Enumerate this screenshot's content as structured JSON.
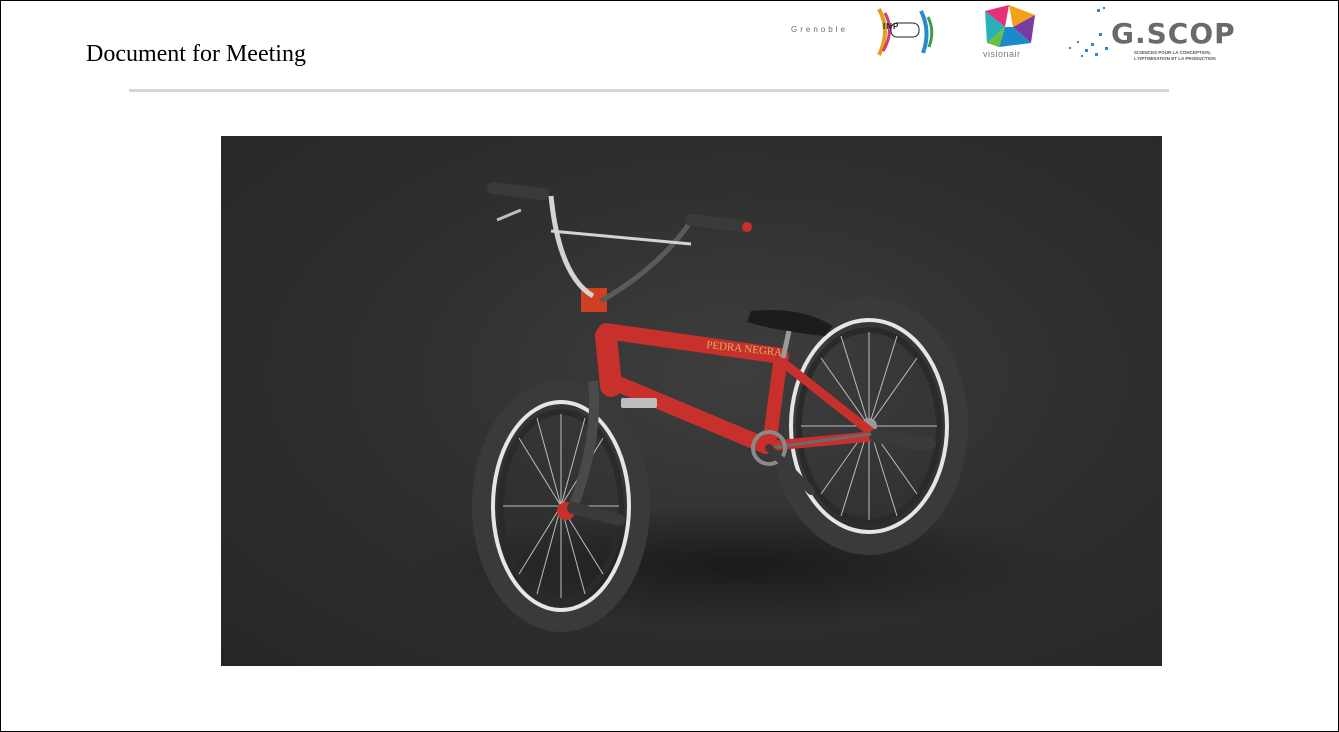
{
  "slide": {
    "title": "Document for Meeting"
  },
  "logos": {
    "grenoble": {
      "word": "Grenoble",
      "badge": "INP"
    },
    "visionair": {
      "word": "visionair"
    },
    "gscop": {
      "word": "G.SCOP",
      "tagline_line1": "SCIENCES POUR LA CONCEPTION,",
      "tagline_line2": "L'OPTIMISATION ET LA PRODUCTION"
    }
  },
  "photo": {
    "subject": "bmx-bike-render",
    "frame_label": "PEDRA NEGRA",
    "colors": {
      "background": "#2f2f2f",
      "frame": "#c8302c",
      "tire": "#3a3a3a",
      "tire_wall": "#e6e6e6",
      "chrome": "#cfcfcf"
    }
  }
}
